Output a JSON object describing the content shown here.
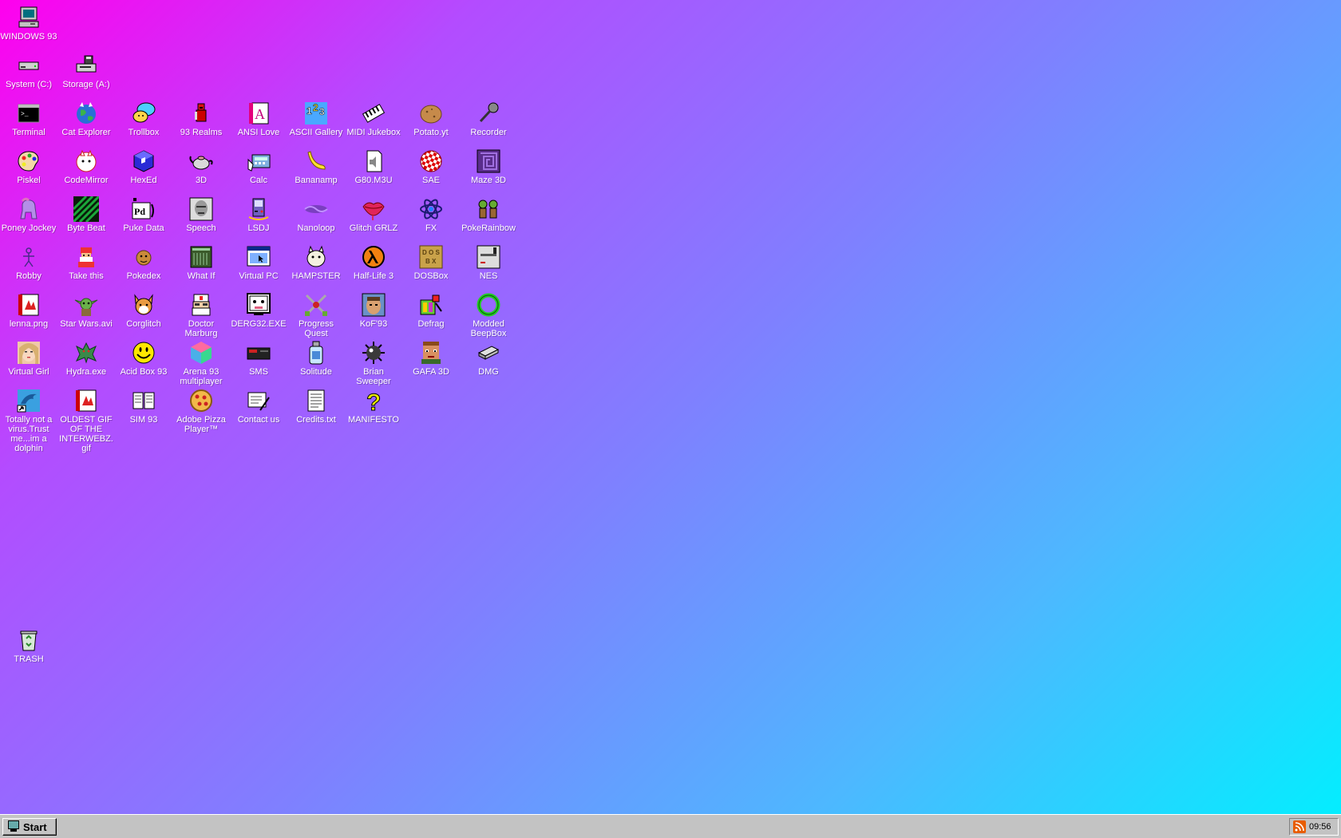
{
  "desktop": {
    "windows93": "WINDOWS 93",
    "system_c": "System (C:)",
    "storage_a": "Storage (A:)",
    "terminal": "Terminal",
    "cat_explorer": "Cat Explorer",
    "trollbox": "Trollbox",
    "realms": "93 Realms",
    "ansi_love": "ANSI Love",
    "ascii_gallery": "ASCII Gallery",
    "midi_jukebox": "MIDI Jukebox",
    "potato": "Potato.yt",
    "recorder": "Recorder",
    "piskel": "Piskel",
    "codemirror": "CodeMirror",
    "hexed": "HexEd",
    "three_d": "3D",
    "calc": "Calc",
    "bananamp": "Bananamp",
    "g80": "G80.M3U",
    "sae": "SAE",
    "maze3d": "Maze 3D",
    "poney": "Poney Jockey",
    "bytebeat": "Byte Beat",
    "puke": "Puke Data",
    "speech": "Speech",
    "lsdj": "LSDJ",
    "nanoloop": "Nanoloop",
    "glitch": "Glitch GRLZ",
    "fx": "FX",
    "pokerainbow": "PokeRainbow",
    "robby": "Robby",
    "takethis": "Take this",
    "pokedex": "Pokedex",
    "whatif": "What If",
    "virtualpc": "Virtual PC",
    "hampster": "HAMPSTER",
    "halflife": "Half-Life 3",
    "dosbox": "DOSBox",
    "nes": "NES",
    "lenna": "lenna.png",
    "starwars": "Star Wars.avi",
    "corglitch": "Corglitch",
    "marburg": "Doctor Marburg",
    "derg": "DERG32.EXE",
    "progress": "Progress Quest",
    "kof": "KoF'93",
    "defrag": "Defrag",
    "beepbox": "Modded BeepBox",
    "virtualgirl": "Virtual Girl",
    "hydra": "Hydra.exe",
    "acidbox": "Acid Box 93",
    "arena": "Arena 93 multiplayer",
    "sms": "SMS",
    "solitude": "Solitude",
    "brian": "Brian Sweeper",
    "gafa": "GAFA 3D",
    "dmg": "DMG",
    "dolphin": "Totally not a virus.Trust me...im a dolphin",
    "oldestgif": "OLDEST GIF OF THE INTERWEBZ.gif",
    "sim93": "SIM 93",
    "pizza": "Adobe Pizza Player™",
    "contact": "Contact us",
    "credits": "Credits.txt",
    "manifesto": "MANIFESTO",
    "trash": "TRASH"
  },
  "taskbar": {
    "start_label": "Start",
    "clock": "09:56"
  },
  "colors": {
    "gradient_start": "#ff00ee",
    "gradient_mid": "#7f80ff",
    "gradient_end": "#00f0ff",
    "taskbar": "#c3c3c3"
  }
}
